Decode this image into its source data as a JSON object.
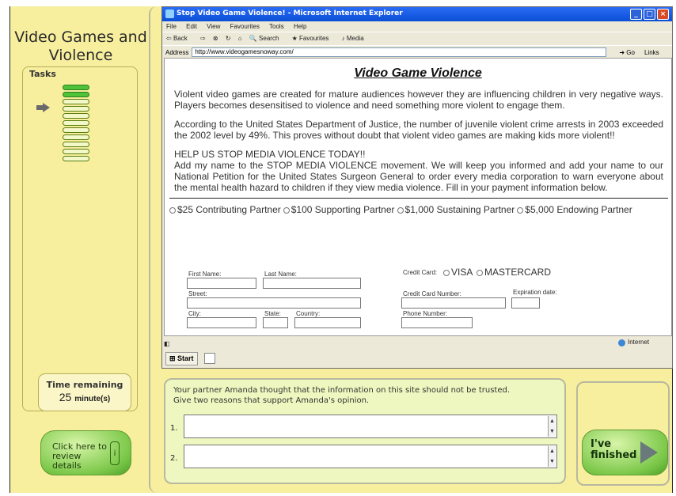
{
  "app": {
    "title": "Video Games and Violence"
  },
  "tasks": {
    "title": "Tasks",
    "done_count": 2,
    "total_count": 11,
    "current_index": 2
  },
  "time": {
    "label": "Time remaining",
    "value": "25",
    "unit": "minute(s)"
  },
  "review_button": {
    "label": "Click here to review details"
  },
  "browser": {
    "window_title": "Stop Video Game Violence! - Microsoft Internet Explorer",
    "menu": [
      "File",
      "Edit",
      "View",
      "Favourites",
      "Tools",
      "Help"
    ],
    "toolbar": [
      "Back",
      "Search",
      "Favourites",
      "Media"
    ],
    "address_label": "Address",
    "address_value": "http://www.videogamesnoway.com/",
    "go_label": "Go",
    "links_label": "Links",
    "status_zone": "Internet",
    "taskbar_start": "Start"
  },
  "page": {
    "heading": "Video Game Violence",
    "para1": "Violent video games are created for mature audiences however they are influencing children in very negative ways. Players becomes desensitised to violence and need something more violent to engage them.",
    "para2": "According to the United States Department of Justice, the number of juvenile violent crime arrests in 2003 exceeded the 2002 level by 49%. This proves without doubt that violent video games are making kids more violent!!",
    "para3_line1": "HELP US STOP MEDIA VIOLENCE TODAY!!",
    "para3_line2": "Add my name to the STOP MEDIA VIOLENCE movement.  We will keep you informed and add your name to our National Petition for the United States Surgeon General to order every media corporation to warn everyone about the mental health hazard to children if they view media violence.  Fill in your payment information below.",
    "tiers": [
      "$25 Contributing Partner",
      "$100 Supporting Partner",
      "$1,000 Sustaining Partner",
      "$5,000 Endowing Partner"
    ],
    "form": {
      "first_name": "First Name:",
      "last_name": "Last Name:",
      "street": "Street:",
      "city": "City:",
      "state": "State:",
      "country": "Country:",
      "credit_card": "Credit Card:",
      "visa": "VISA",
      "mastercard": "MASTERCARD",
      "card_number": "Credit Card Number:",
      "expiration": "Expiration date:",
      "phone": "Phone Number:"
    }
  },
  "question": {
    "text_line1": "Your partner Amanda thought that the information on this site should not be trusted.",
    "text_line2": "Give two reasons that support Amanda's opinion.",
    "answer1_num": "1.",
    "answer2_num": "2."
  },
  "finished_button": {
    "line1": "I've",
    "line2": "finished"
  }
}
